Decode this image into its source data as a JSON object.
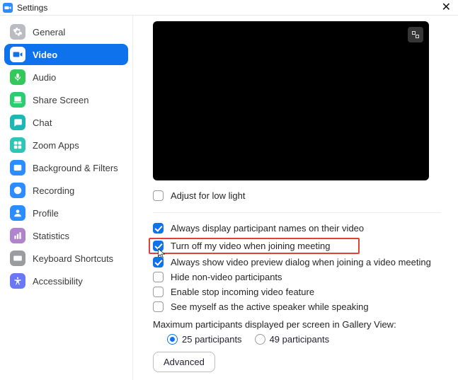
{
  "window": {
    "title": "Settings"
  },
  "sidebar": {
    "items": [
      {
        "id": "general",
        "label": "General",
        "color": "#B9BDC1",
        "active": false
      },
      {
        "id": "video",
        "label": "Video",
        "color": "#0E72ED",
        "active": true
      },
      {
        "id": "audio",
        "label": "Audio",
        "color": "#34C759",
        "active": false
      },
      {
        "id": "share",
        "label": "Share Screen",
        "color": "#2ECC71",
        "active": false
      },
      {
        "id": "chat",
        "label": "Chat",
        "color": "#1FB6B6",
        "active": false
      },
      {
        "id": "apps",
        "label": "Zoom Apps",
        "color": "#2EC4B6",
        "active": false
      },
      {
        "id": "bgfilters",
        "label": "Background & Filters",
        "color": "#2D8CFF",
        "active": false
      },
      {
        "id": "recording",
        "label": "Recording",
        "color": "#2D8CFF",
        "active": false
      },
      {
        "id": "profile",
        "label": "Profile",
        "color": "#2D8CFF",
        "active": false
      },
      {
        "id": "stats",
        "label": "Statistics",
        "color": "#B084CC",
        "active": false
      },
      {
        "id": "keyboard",
        "label": "Keyboard Shortcuts",
        "color": "#9A9DA0",
        "active": false
      },
      {
        "id": "a11y",
        "label": "Accessibility",
        "color": "#6B78F5",
        "active": false
      }
    ]
  },
  "video": {
    "adjust_low_light": {
      "label": "Adjust for low light",
      "checked": false
    },
    "options": [
      {
        "id": "display_names",
        "label": "Always display participant names on their video",
        "checked": true,
        "highlight": false
      },
      {
        "id": "turn_off_video",
        "label": "Turn off my video when joining meeting",
        "checked": true,
        "highlight": true
      },
      {
        "id": "show_preview",
        "label": "Always show video preview dialog when joining a video meeting",
        "checked": true,
        "highlight": false
      },
      {
        "id": "hide_nonvideo",
        "label": "Hide non-video participants",
        "checked": false,
        "highlight": false
      },
      {
        "id": "stop_incoming",
        "label": "Enable stop incoming video feature",
        "checked": false,
        "highlight": false
      },
      {
        "id": "see_self_active",
        "label": "See myself as the active speaker while speaking",
        "checked": false,
        "highlight": false
      }
    ],
    "gallery": {
      "label": "Maximum participants displayed per screen in Gallery View:",
      "options": [
        {
          "label": "25 participants",
          "selected": true
        },
        {
          "label": "49 participants",
          "selected": false
        }
      ]
    },
    "advanced_button": "Advanced"
  }
}
